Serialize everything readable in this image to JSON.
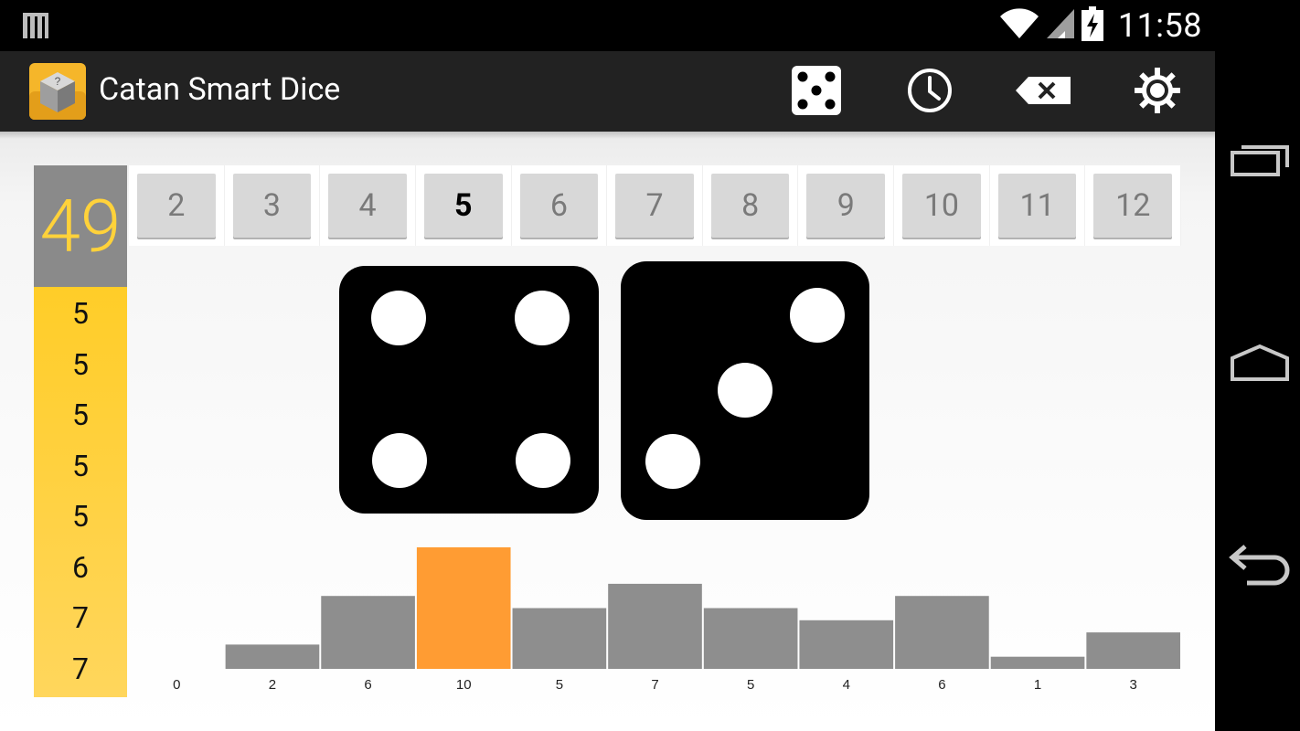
{
  "status_bar": {
    "time": "11:58",
    "icons": [
      "notification-icon",
      "wifi-icon",
      "signal-icon",
      "battery-charging-icon"
    ]
  },
  "action_bar": {
    "title": "Catan Smart Dice",
    "actions": [
      "roll-dice-icon",
      "clock-icon",
      "backspace-icon",
      "settings-icon"
    ]
  },
  "history": {
    "total_rolls": "49",
    "recent_rolls": [
      "5",
      "5",
      "5",
      "5",
      "5",
      "6",
      "7",
      "7"
    ]
  },
  "number_buttons": {
    "labels": [
      "2",
      "3",
      "4",
      "5",
      "6",
      "7",
      "8",
      "9",
      "10",
      "11",
      "12"
    ],
    "selected": "5"
  },
  "dice": {
    "left_value": 4,
    "right_value": 3
  },
  "chart_data": {
    "type": "bar",
    "categories": [
      "2",
      "3",
      "4",
      "5",
      "6",
      "7",
      "8",
      "9",
      "10",
      "11",
      "12"
    ],
    "values": [
      0,
      2,
      6,
      10,
      5,
      7,
      5,
      4,
      6,
      1,
      3
    ],
    "highlighted_category": "5",
    "colors": {
      "bar": "#8e8e8e",
      "highlight": "#ff9c33"
    },
    "title": "",
    "xlabel": "",
    "ylabel": ""
  },
  "colors": {
    "accent_yellow": "#ffcd28",
    "action_bar": "#222222"
  }
}
